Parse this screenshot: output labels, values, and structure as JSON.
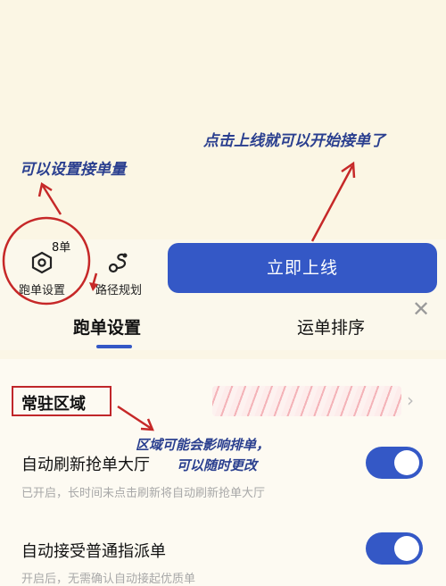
{
  "toolbar": {
    "order_count_badge": "8单",
    "run_settings_label": "跑单设置",
    "route_planning_label": "路径规划",
    "go_online_label": "立即上线"
  },
  "tabs": [
    {
      "label": "跑单设置",
      "active": true
    },
    {
      "label": "运单排序",
      "active": false
    }
  ],
  "section": {
    "title": "常驻区域"
  },
  "settings": [
    {
      "title": "自动刷新抢单大厅",
      "desc": "已开启，长时间未点击刷新将自动刷新抢单大厅",
      "enabled": true
    },
    {
      "title": "自动接受普通指派单",
      "desc": "开启后，无需确认自动接起优质单",
      "enabled": true
    }
  ],
  "annotations": {
    "online_hint": "点击上线就可以开始接单了",
    "order_count_hint": "可以设置接单量",
    "area_hint_line1": "区域可能会影响排单，",
    "area_hint_line2": "可以随时更改"
  },
  "colors": {
    "accent": "#3458c6",
    "annotation_red": "#c62828",
    "annotation_text": "#2a3f8f",
    "background": "#fbf6e6"
  },
  "icons": {
    "run_settings": "hexagon-gear-icon",
    "route_planning": "route-path-icon",
    "close": "close-icon",
    "chevron": "chevron-right-icon"
  }
}
